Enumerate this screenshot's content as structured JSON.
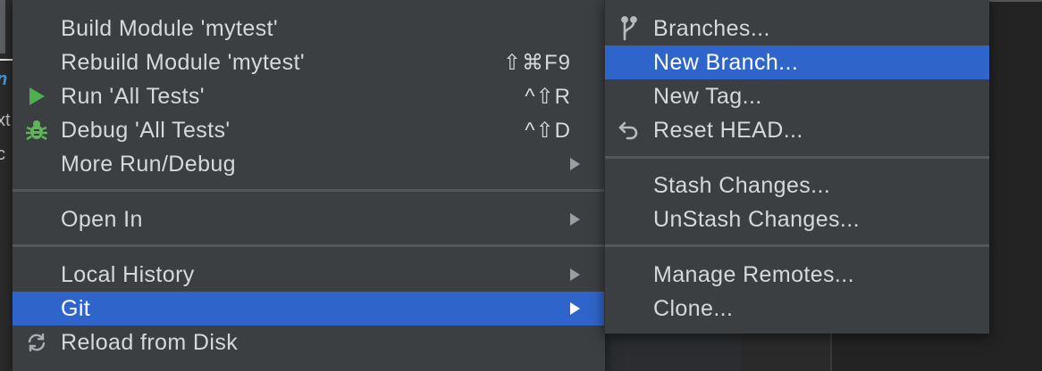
{
  "main_menu": {
    "items": [
      {
        "label": "Build Module 'mytest'",
        "shortcut": ""
      },
      {
        "label": "Rebuild Module 'mytest'",
        "shortcut": "⇧⌘F9"
      },
      {
        "label": "Run 'All Tests'",
        "shortcut": "^⇧R",
        "icon": "run-icon"
      },
      {
        "label": "Debug 'All Tests'",
        "shortcut": "^⇧D",
        "icon": "debug-bug-icon"
      },
      {
        "label": "More Run/Debug",
        "submenu": true
      },
      {
        "label": "Open In",
        "submenu": true
      },
      {
        "label": "Local History",
        "submenu": true
      },
      {
        "label": "Git",
        "submenu": true,
        "selected": true
      },
      {
        "label": "Reload from Disk",
        "icon": "reload-icon"
      }
    ]
  },
  "git_submenu": {
    "items": [
      {
        "label": "Branches...",
        "icon": "branch-icon"
      },
      {
        "label": "New Branch...",
        "selected": true
      },
      {
        "label": "New Tag..."
      },
      {
        "label": "Reset HEAD...",
        "icon": "undo-icon"
      },
      {
        "label": "Stash Changes..."
      },
      {
        "label": "UnStash Changes..."
      },
      {
        "label": "Manage Remotes..."
      },
      {
        "label": "Clone..."
      }
    ]
  },
  "background": {
    "left_fragments": [
      "n",
      "xt",
      "c"
    ]
  },
  "colors": {
    "menu_bg": "#3c3f41",
    "selection": "#2f65ca",
    "run_green": "#4caf50",
    "debug_green": "#5fb557",
    "separator": "#545759"
  }
}
